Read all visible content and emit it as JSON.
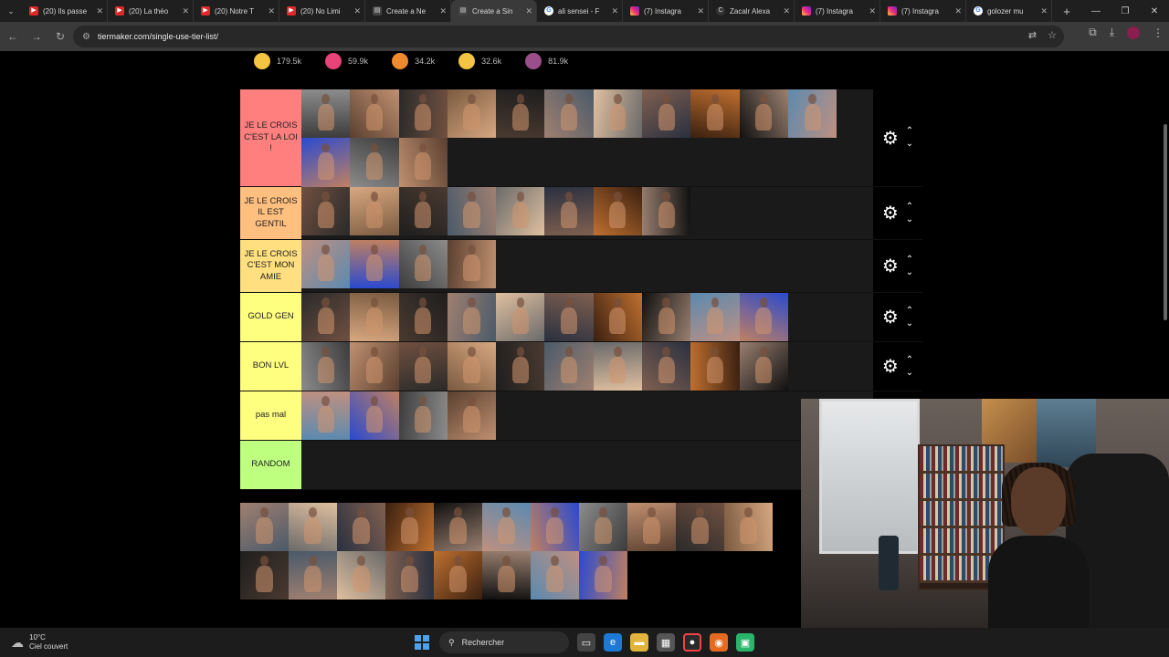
{
  "browser": {
    "tabs": [
      {
        "title": "(20) Ils passe",
        "icon": "youtube-icon"
      },
      {
        "title": "(20) La théo",
        "icon": "youtube-icon"
      },
      {
        "title": "(20) Notre T",
        "icon": "youtube-icon"
      },
      {
        "title": "(20) No Limi",
        "icon": "youtube-icon"
      },
      {
        "title": "Create a Ne",
        "icon": "tiermaker-icon"
      },
      {
        "title": "Create a Sin",
        "icon": "tiermaker-icon",
        "active": true
      },
      {
        "title": "ali sensei - F",
        "icon": "google-icon"
      },
      {
        "title": "(7) Instagra",
        "icon": "instagram-icon"
      },
      {
        "title": "Zacalr Alexa",
        "icon": "site-icon"
      },
      {
        "title": "(7) Instagra",
        "icon": "instagram-icon"
      },
      {
        "title": "(7) Instagra",
        "icon": "instagram-icon"
      },
      {
        "title": "golozer mu",
        "icon": "google-icon"
      }
    ],
    "url": "tiermaker.com/single-use-tier-list/"
  },
  "reactions": [
    {
      "count": "179.5k",
      "color": "#f4c542"
    },
    {
      "count": "59.9k",
      "color": "#e8447a"
    },
    {
      "count": "34.2k",
      "color": "#f08a2e"
    },
    {
      "count": "32.6k",
      "color": "#f4c542"
    },
    {
      "count": "81.9k",
      "color": "#9b4f8a"
    }
  ],
  "tiers": [
    {
      "label": "JE LE CROIS C'EST LA LOI !",
      "color": "#ff7f7f",
      "count": 14
    },
    {
      "label": "JE LE CROIS IL EST GENTIL",
      "color": "#ffbf7f",
      "count": 8
    },
    {
      "label": "JE LE CROIS C'EST MON AMIE",
      "color": "#ffdf7f",
      "count": 4
    },
    {
      "label": "GOLD GEN",
      "color": "#ffff7f",
      "count": 10
    },
    {
      "label": "BON LVL",
      "color": "#ffff7f",
      "count": 10
    },
    {
      "label": "pas mal",
      "color": "#ffff7f",
      "count": 4
    },
    {
      "label": "RANDOM",
      "color": "#bfff7f",
      "count": 0
    }
  ],
  "pool_count": 19,
  "taskbar": {
    "temperature": "10°C",
    "weather": "Ciel couvert",
    "search_placeholder": "Rechercher"
  }
}
